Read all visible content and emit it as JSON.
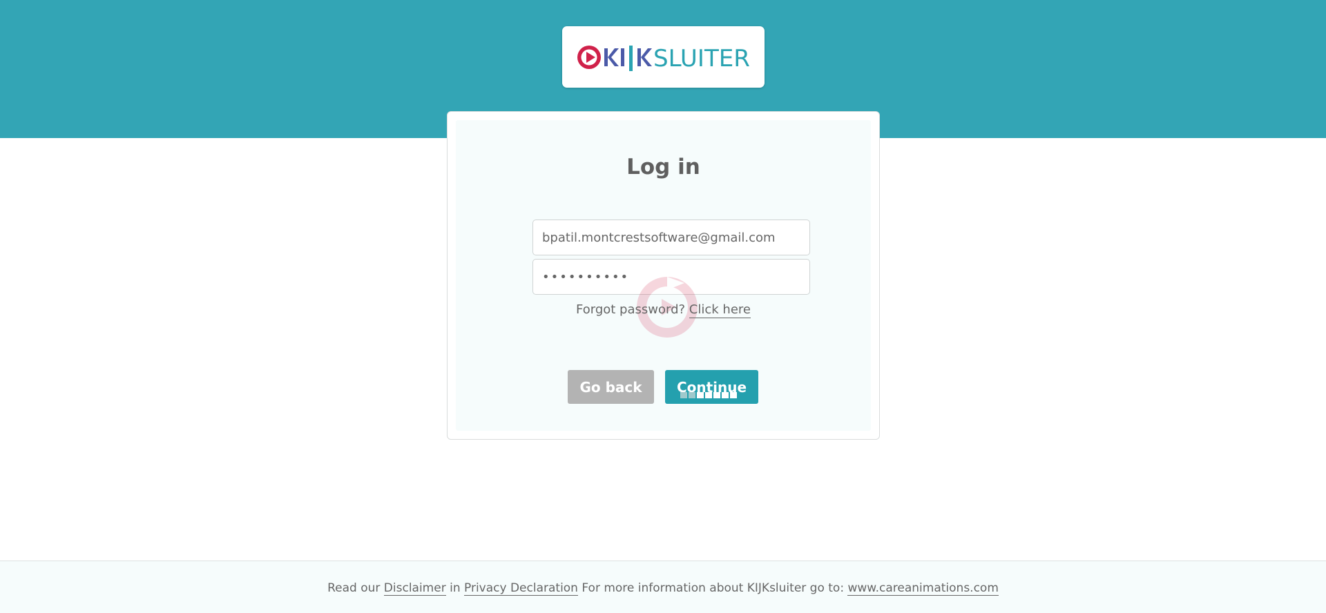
{
  "header": {
    "logo_text": "KIJKSLUITER",
    "colors": {
      "band": "#33a5b5",
      "logo_red": "#d0214a",
      "logo_blue": "#4b5aa8",
      "logo_teal": "#2aa3b2"
    }
  },
  "login": {
    "title": "Log in",
    "email_value": "bpatil.montcrestsoftware@gmail.com",
    "password_value": "••••••••••",
    "forgot_text": "Forgot password?",
    "forgot_link": "Click here",
    "back_label": "Go back",
    "continue_label": "Continue"
  },
  "footer": {
    "prefix": "Read our",
    "disclaimer": "Disclaimer",
    "and": "in",
    "privacy": "Privacy Declaration",
    "info": "For more information about KIJKsluiter go to:",
    "site": "www.careanimations.com"
  }
}
